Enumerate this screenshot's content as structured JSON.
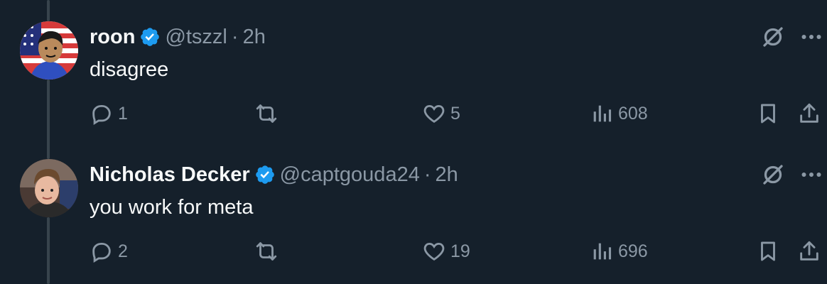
{
  "tweets": [
    {
      "author_name": "roon",
      "handle": "@tszzl",
      "separator": "·",
      "time": "2h",
      "text": "disagree",
      "replies": "1",
      "retweets": "",
      "likes": "5",
      "views": "608",
      "avatar": "cartoon-flag-avatar"
    },
    {
      "author_name": "Nicholas Decker",
      "handle": "@captgouda24",
      "separator": "·",
      "time": "2h",
      "text": "you work for meta",
      "replies": "2",
      "retweets": "",
      "likes": "19",
      "views": "696",
      "avatar": "photo-avatar"
    }
  ],
  "colors": {
    "background": "#15202b",
    "text": "#f7f9f9",
    "muted": "#8b98a5",
    "verified": "#1d9bf0",
    "thread_line": "#38444d"
  }
}
